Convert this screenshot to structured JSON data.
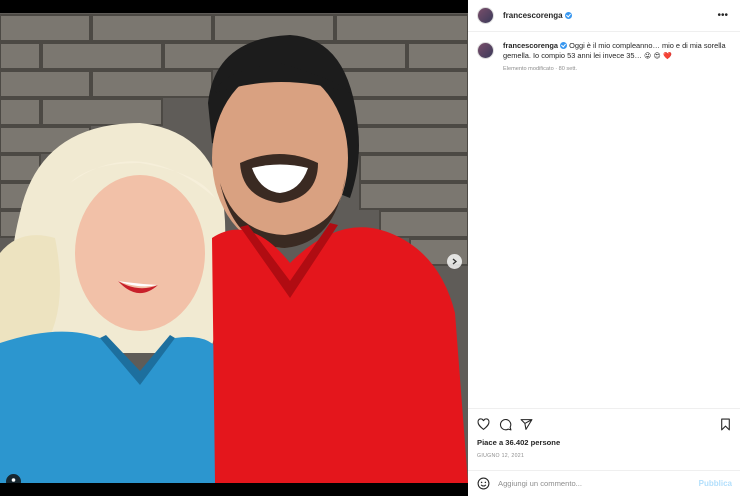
{
  "post": {
    "username": "francescorenga",
    "caption_text": "Oggi è il mio compleanno… mio e di mia sorella gemella. Io compio 53 anni lei invece 35…",
    "caption_emojis": "😜 😍 ❤️",
    "caption_meta": "Elemento modificato · 80 sett.",
    "likes": "Piace a 36.402 persone",
    "date": "GIUGNO 12, 2021",
    "comment_placeholder": "Aggiungi un commento...",
    "post_label": "Pubblica",
    "more_label": "•••"
  },
  "carousel": {
    "total": 2,
    "current": 1
  },
  "icons": [
    "heart-icon",
    "comment-icon",
    "share-icon",
    "bookmark-icon",
    "emoji-icon",
    "chevron-right-icon",
    "user-tag-icon",
    "more-icon"
  ],
  "colors": {
    "verified": "#3897f0",
    "post_button": "#b2dffc",
    "carousel_active": "#1e90ff"
  }
}
